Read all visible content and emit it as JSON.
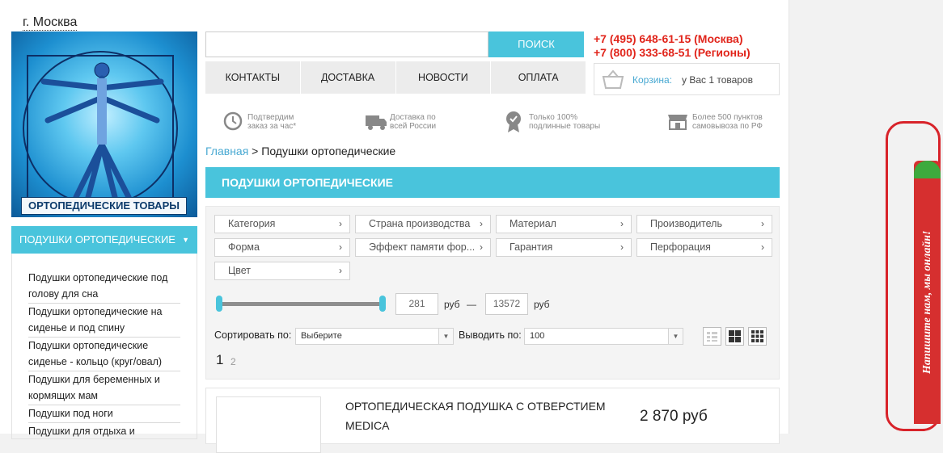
{
  "header": {
    "city": "г. Москва",
    "logo_text": "ОРТОПЕДИЧЕСКИЕ ТОВАРЫ",
    "search_placeholder": "",
    "search_button": "ПОИСК",
    "phone_moscow": "+7 (495) 648-61-15 (Москва)",
    "phone_regions": "+7 (800) 333-68-51 (Регионы)",
    "nav": [
      "КОНТАКТЫ",
      "ДОСТАВКА",
      "НОВОСТИ",
      "ОПЛАТА"
    ],
    "cart_label": "Корзина:",
    "cart_count": "у Вас 1 товаров"
  },
  "features": [
    {
      "icon": "confirm-clock-icon",
      "line1": "Подтвердим",
      "line2": "заказ за час*"
    },
    {
      "icon": "delivery-truck-icon",
      "line1": "Доставка по",
      "line2": "всей России"
    },
    {
      "icon": "original-badge-icon",
      "line1": "Только 100%",
      "line2": "подлинные товары"
    },
    {
      "icon": "pickup-store-icon",
      "line1": "Более 500 пунктов",
      "line2": "самовывоза по РФ"
    }
  ],
  "sidebar": {
    "heading": "ПОДУШКИ ОРТОПЕДИЧЕСКИЕ",
    "items": [
      "Подушки ортопедические под голову для сна",
      "Подушки ортопедические на сиденье и под спину",
      "Подушки ортопедические сиденье - кольцо (круг/овал)",
      "Подушки для беременных и кормящих мам",
      "Подушки под ноги",
      "Подушки для отдыха и"
    ]
  },
  "breadcrumb": {
    "home": "Главная",
    "separator": " > ",
    "current": "Подушки ортопедические"
  },
  "title": "ПОДУШКИ ОРТОПЕДИЧЕСКИЕ",
  "filters": [
    "Категория",
    "Страна производства",
    "Материал",
    "Производитель",
    "Форма",
    "Эффект памяти фор...",
    "Гарантия",
    "Перфорация",
    "Цвет"
  ],
  "price": {
    "min": "281",
    "max": "13572",
    "unit": "руб",
    "dash": "—"
  },
  "sort": {
    "label": "Сортировать по:",
    "value": "Выберите",
    "show_label": "Выводить по:",
    "show_value": "100"
  },
  "pagination": [
    "1",
    "2"
  ],
  "product": {
    "name": "ОРТОПЕДИЧЕСКАЯ ПОДУШКА С ОТВЕРСТИЕМ MEDICA",
    "price": "2 870 руб"
  },
  "chat": {
    "text": "Напишите нам, мы онлайн!"
  },
  "colors": {
    "accent": "#49c4dc",
    "phone": "#e1251b",
    "chat": "#d62f2f"
  }
}
